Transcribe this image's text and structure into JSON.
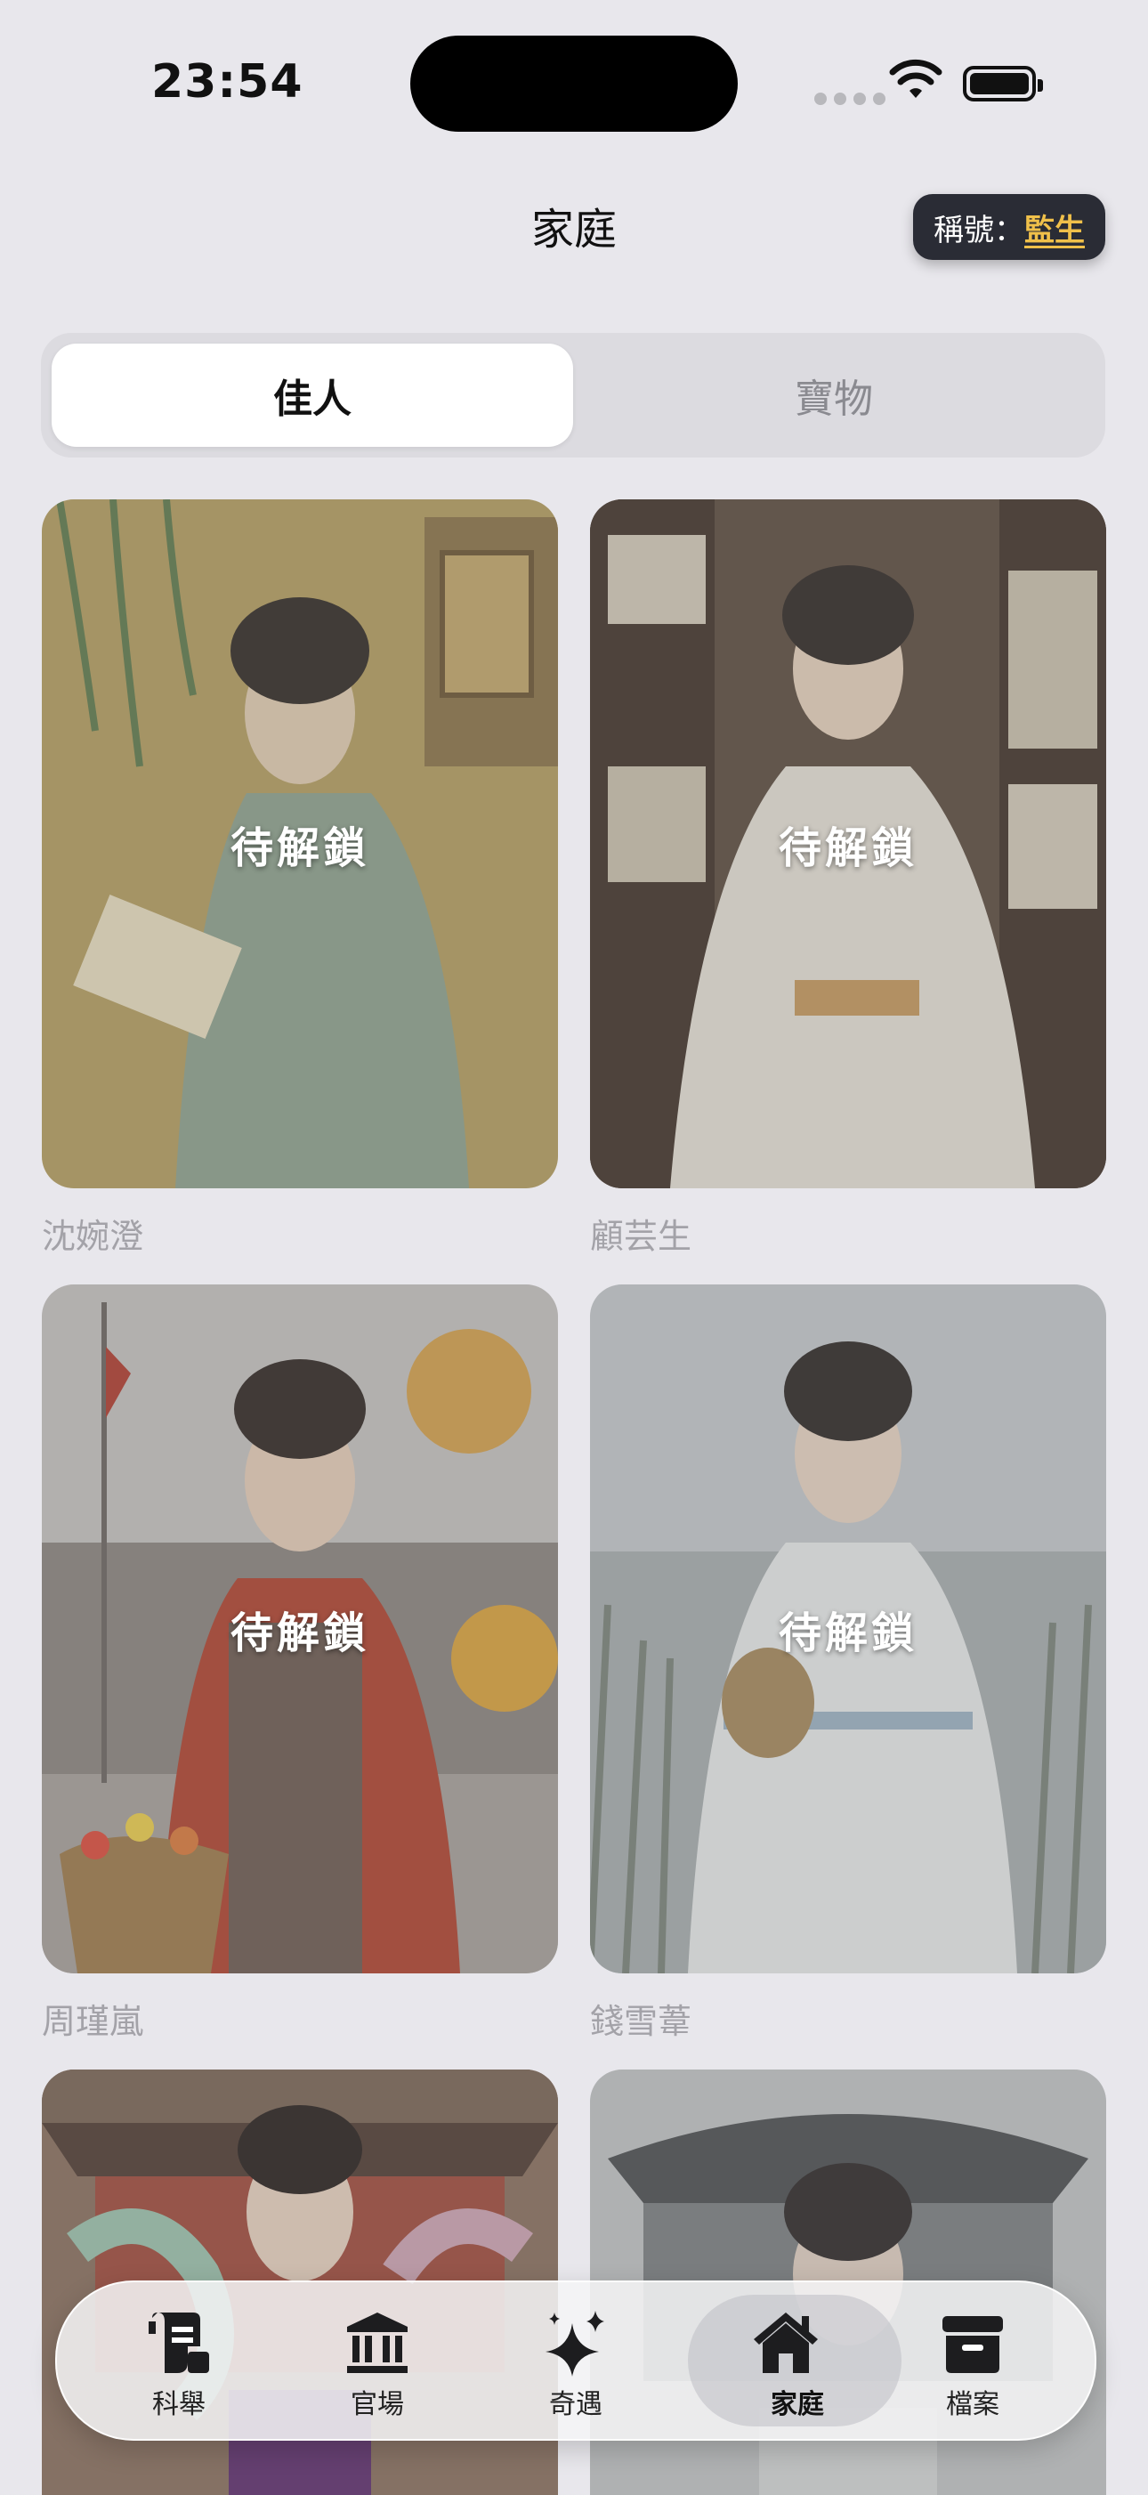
{
  "status": {
    "time": "23:54"
  },
  "header": {
    "title": "家庭",
    "badge_prefix": "稱號：",
    "badge_rank": "監生"
  },
  "segments": [
    {
      "label": "佳人",
      "active": true
    },
    {
      "label": "寶物",
      "active": false
    }
  ],
  "lock_label": "待解鎖",
  "cards": [
    {
      "name": "沈婉澄"
    },
    {
      "name": "顧芸生"
    },
    {
      "name": "周瑾嵐"
    },
    {
      "name": "錢雪葦"
    },
    {
      "name": ""
    },
    {
      "name": ""
    }
  ],
  "tabs": [
    {
      "label": "科舉",
      "icon": "scroll-icon"
    },
    {
      "label": "官場",
      "icon": "bank-icon"
    },
    {
      "label": "奇遇",
      "icon": "sparkles-icon"
    },
    {
      "label": "家庭",
      "icon": "house-icon",
      "active": true
    },
    {
      "label": "檔案",
      "icon": "archive-box-icon"
    }
  ]
}
